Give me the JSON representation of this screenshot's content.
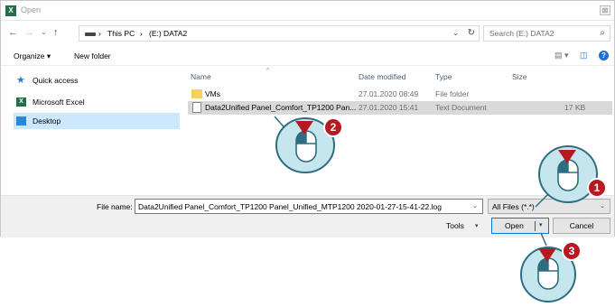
{
  "window": {
    "app_icon_letter": "X",
    "title": "Open",
    "close_glyph": "⊠"
  },
  "address": {
    "back_glyph": "←",
    "forward_glyph": "→",
    "recent_glyph": "⌄",
    "up_glyph": "↑",
    "crumbs": [
      "This PC",
      "›",
      "(E:) DATA2"
    ],
    "crumb_lead_separator": "›",
    "dropdown_glyph": "⌄",
    "refresh_glyph": "↻",
    "search_placeholder": "Search (E:) DATA2",
    "search_glyph": "⌕"
  },
  "command_bar": {
    "organize_label": "Organize ▾",
    "new_folder_label": "New folder",
    "view_glyph": "▤ ▾",
    "pane_glyph": "◫",
    "help_glyph": "?"
  },
  "nav_pane": {
    "items": [
      {
        "label": "Quick access",
        "icon": "star-icon"
      },
      {
        "label": "Microsoft Excel",
        "icon": "excel-icon"
      },
      {
        "label": "Desktop",
        "icon": "desktop-icon",
        "selected": true
      }
    ]
  },
  "file_list": {
    "columns": [
      "Name",
      "Date modified",
      "Type",
      "Size"
    ],
    "sort_glyph": "^",
    "rows": [
      {
        "name": "VMs",
        "date": "27.01.2020 08:49",
        "type": "File folder",
        "size": "",
        "icon": "folder-icon"
      },
      {
        "name": "Data2Unified Panel_Comfort_TP1200 Pan...",
        "date": "27.01.2020 15:41",
        "type": "Text Document",
        "size": "17 KB",
        "icon": "text-document-icon",
        "selected": true
      }
    ]
  },
  "bottom": {
    "file_name_label": "File name:",
    "file_name_value": "Data2Unified Panel_Comfort_TP1200 Panel_Unified_MTP1200 2020-01-27-15-41-22.log",
    "file_type_value": "All Files (*.*)",
    "tools_label": "Tools",
    "open_label": "Open",
    "cancel_label": "Cancel",
    "chevron": "⌄",
    "tools_chevron": "▾",
    "open_chevron": "▾"
  },
  "callouts": [
    {
      "number": "1"
    },
    {
      "number": "2"
    },
    {
      "number": "3"
    }
  ],
  "colors": {
    "callout_fill": "#c6e6ee",
    "callout_stroke": "#2f6d82",
    "badge": "#b8191f",
    "selection": "#cce8ff"
  }
}
